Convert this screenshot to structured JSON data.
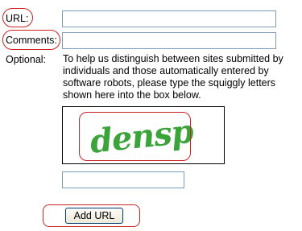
{
  "form": {
    "url_label": "URL:",
    "url_value": "",
    "comments_label": "Comments:",
    "comments_value": "",
    "optional_label": "Optional:",
    "help_lines": [
      "To help us distinguish between sites submitted by",
      "individuals and those automatically entered by",
      "software robots, please type the squiggly letters",
      "shown here into the box below."
    ],
    "captcha_text": "densp",
    "captcha_value": "",
    "submit_label": "Add URL"
  },
  "colors": {
    "highlight_ring": "#cc2222",
    "captcha_text": "#3aa33a",
    "input_border": "#7f9db9"
  }
}
